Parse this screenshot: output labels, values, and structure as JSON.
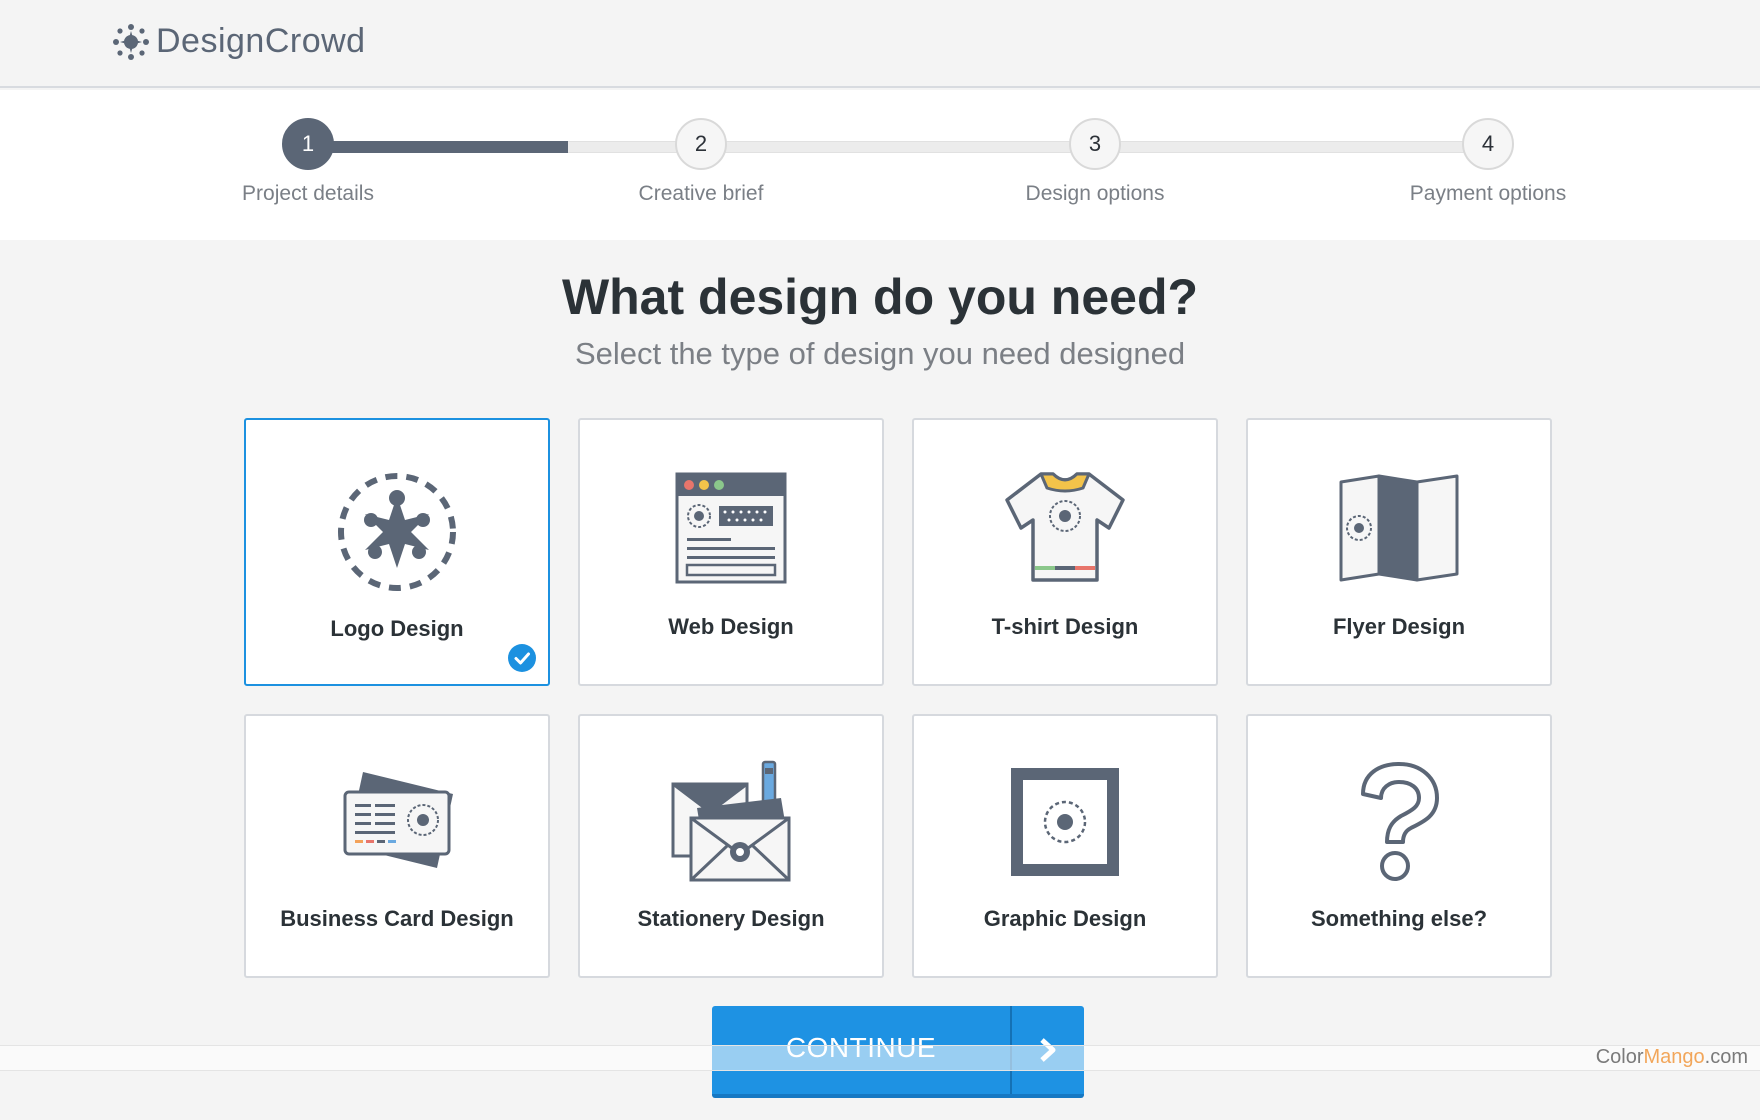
{
  "brand": {
    "name": "DesignCrowd"
  },
  "steps": [
    {
      "number": "1",
      "label": "Project details",
      "active": true
    },
    {
      "number": "2",
      "label": "Creative brief",
      "active": false
    },
    {
      "number": "3",
      "label": "Design options",
      "active": false
    },
    {
      "number": "4",
      "label": "Payment options",
      "active": false
    }
  ],
  "progress": {
    "fraction": 0.22
  },
  "page": {
    "heading": "What design do you need?",
    "subheading": "Select the type of design you need designed"
  },
  "options": [
    {
      "label": "Logo Design",
      "icon": "logo-icon",
      "selected": true
    },
    {
      "label": "Web Design",
      "icon": "browser-window-icon",
      "selected": false
    },
    {
      "label": "T-shirt Design",
      "icon": "tshirt-icon",
      "selected": false
    },
    {
      "label": "Flyer Design",
      "icon": "folded-flyer-icon",
      "selected": false
    },
    {
      "label": "Business Card Design",
      "icon": "business-card-icon",
      "selected": false
    },
    {
      "label": "Stationery Design",
      "icon": "envelope-pen-icon",
      "selected": false
    },
    {
      "label": "Graphic Design",
      "icon": "framed-picture-icon",
      "selected": false
    },
    {
      "label": "Something else?",
      "icon": "question-mark-icon",
      "selected": false
    }
  ],
  "continue_button": {
    "label": "CONTINUE",
    "icon": "chevron-right-icon"
  },
  "watermark": {
    "part1": "Color",
    "part2": "Mango",
    "part3": ".com"
  },
  "colors": {
    "accent": "#1e92e3",
    "slate": "#5b6676",
    "selected_border": "#1c91e0"
  }
}
